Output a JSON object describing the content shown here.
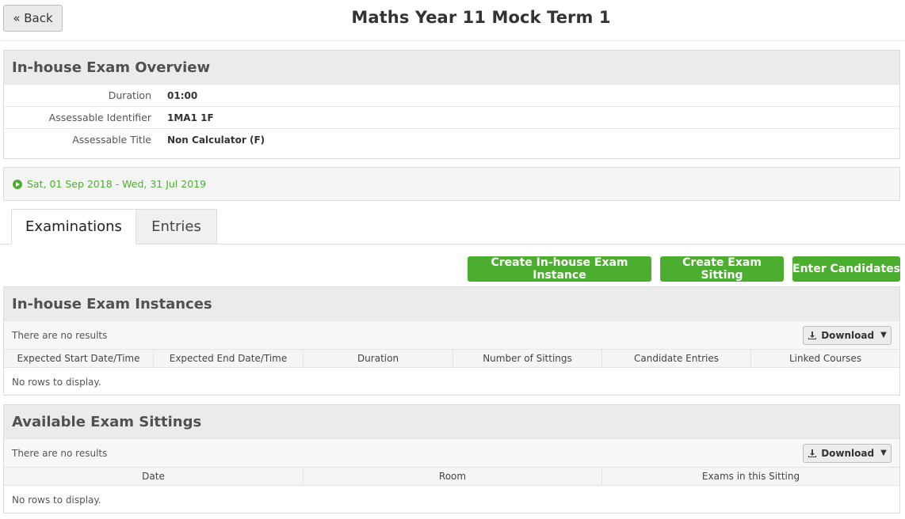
{
  "header": {
    "back_label": "« Back",
    "title": "Maths Year 11 Mock Term 1"
  },
  "overview": {
    "title": "In-house Exam Overview",
    "rows": [
      {
        "label": "Duration",
        "value": "01:00"
      },
      {
        "label": "Assessable Identifier",
        "value": "1MA1 1F"
      },
      {
        "label": "Assessable Title",
        "value": "Non Calculator (F)"
      }
    ]
  },
  "date_range": {
    "icon": "play-circle-icon",
    "text": "Sat, 01 Sep 2018 - Wed, 31 Jul 2019",
    "color": "#4cae2f"
  },
  "tabs": [
    {
      "label": "Examinations",
      "active": true
    },
    {
      "label": "Entries",
      "active": false
    }
  ],
  "actions": {
    "create_instance": "Create In-house Exam Instance",
    "create_sitting": "Create Exam Sitting",
    "enter_candidates": "Enter Candidates",
    "color": "#4cae2f"
  },
  "instances": {
    "title": "In-house Exam Instances",
    "no_results": "There are no results",
    "download_label": "Download",
    "columns": [
      "Expected Start Date/Time",
      "Expected End Date/Time",
      "Duration",
      "Number of Sittings",
      "Candidate Entries",
      "Linked Courses"
    ],
    "empty_text": "No rows to display."
  },
  "sittings": {
    "title": "Available Exam Sittings",
    "no_results": "There are no results",
    "download_label": "Download",
    "columns": [
      "Date",
      "Room",
      "Exams in this Sitting"
    ],
    "empty_text": "No rows to display."
  }
}
